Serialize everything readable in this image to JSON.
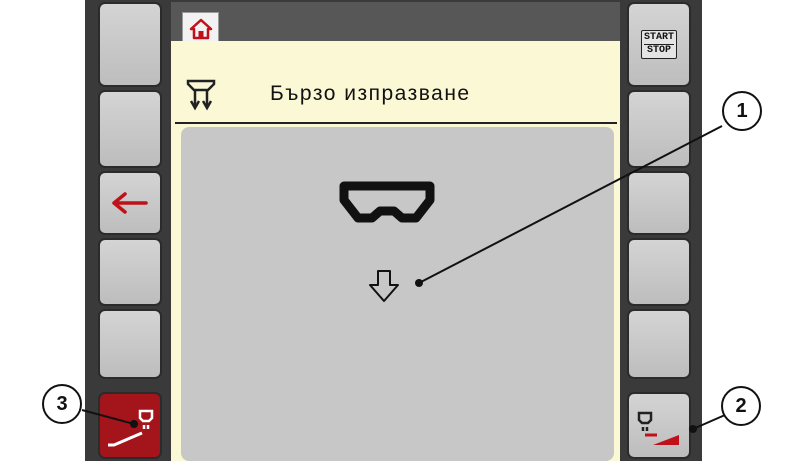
{
  "header": {
    "title": "Бързо изпразване"
  },
  "softkeys": {
    "start_stop_top": "START",
    "start_stop_bottom": "STOP"
  },
  "callouts": [
    "1",
    "2",
    "3"
  ],
  "icons": {
    "home": "home-icon",
    "back": "arrow-left-icon",
    "title": "quick-empty-icon",
    "hopper": "hopper-icon",
    "down": "arrow-down-icon",
    "left_bottom": "empty-left-icon",
    "right_bottom": "empty-right-icon"
  },
  "colors": {
    "accent_red": "#a3141b",
    "screen_bg": "#fbf8d6",
    "panel_bg": "#c7c7c7"
  }
}
